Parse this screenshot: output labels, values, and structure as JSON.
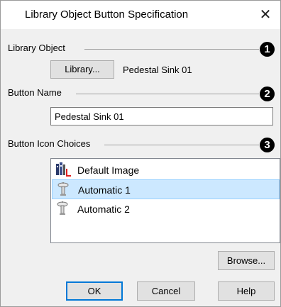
{
  "window": {
    "title": "Library Object Button Specification",
    "close_glyph": "✕"
  },
  "library_object": {
    "group_label": "Library Object",
    "callout": "1",
    "library_button_label": "Library...",
    "object_name": "Pedestal Sink 01"
  },
  "button_name": {
    "group_label": "Button Name",
    "callout": "2",
    "value": "Pedestal Sink 01"
  },
  "button_icon_choices": {
    "group_label": "Button Icon Choices",
    "callout": "3",
    "items": [
      {
        "label": "Default Image",
        "icon": "default-image-icon",
        "selected": false
      },
      {
        "label": "Automatic 1",
        "icon": "pedestal-sink-icon",
        "selected": true
      },
      {
        "label": "Automatic 2",
        "icon": "pedestal-sink-icon",
        "selected": false
      }
    ],
    "browse_label": "Browse..."
  },
  "footer": {
    "ok_label": "OK",
    "cancel_label": "Cancel",
    "help_label": "Help"
  },
  "colors": {
    "selection_fill": "#cce8ff",
    "selection_border": "#99d1ff",
    "default_button_border": "#0078d7",
    "dialog_background": "#f0f0f0"
  }
}
